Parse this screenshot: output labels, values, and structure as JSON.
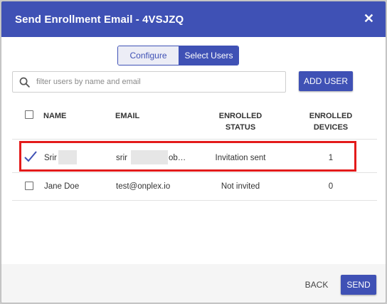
{
  "dialog": {
    "title": "Send Enrollment Email - 4VSJZQ",
    "close_icon": "close-icon",
    "close_glyph": "✕"
  },
  "tabs": [
    {
      "label": "Configure Email",
      "active": false
    },
    {
      "label": "Select Users",
      "active": true
    }
  ],
  "search": {
    "placeholder": "filter users by name and email",
    "value": "",
    "icon": "search-icon"
  },
  "add_user_label": "ADD USER",
  "table": {
    "headers": {
      "name": "NAME",
      "email": "EMAIL",
      "enrolled_status_line1": "ENROLLED",
      "enrolled_status_line2": "STATUS",
      "enrolled_devices_line1": "ENROLLED",
      "enrolled_devices_line2": "DEVICES"
    },
    "rows": [
      {
        "selected": true,
        "name": "Srir",
        "email_prefix": "srir",
        "email_suffix": "ob…",
        "status": "Invitation sent",
        "devices": "1"
      },
      {
        "selected": false,
        "name": "Jane Doe",
        "email": "test@onplex.io",
        "status": "Not invited",
        "devices": "0"
      }
    ]
  },
  "footer": {
    "back_label": "BACK",
    "send_label": "SEND"
  },
  "colors": {
    "primary": "#3f51b5",
    "highlight": "#e31b1b"
  }
}
